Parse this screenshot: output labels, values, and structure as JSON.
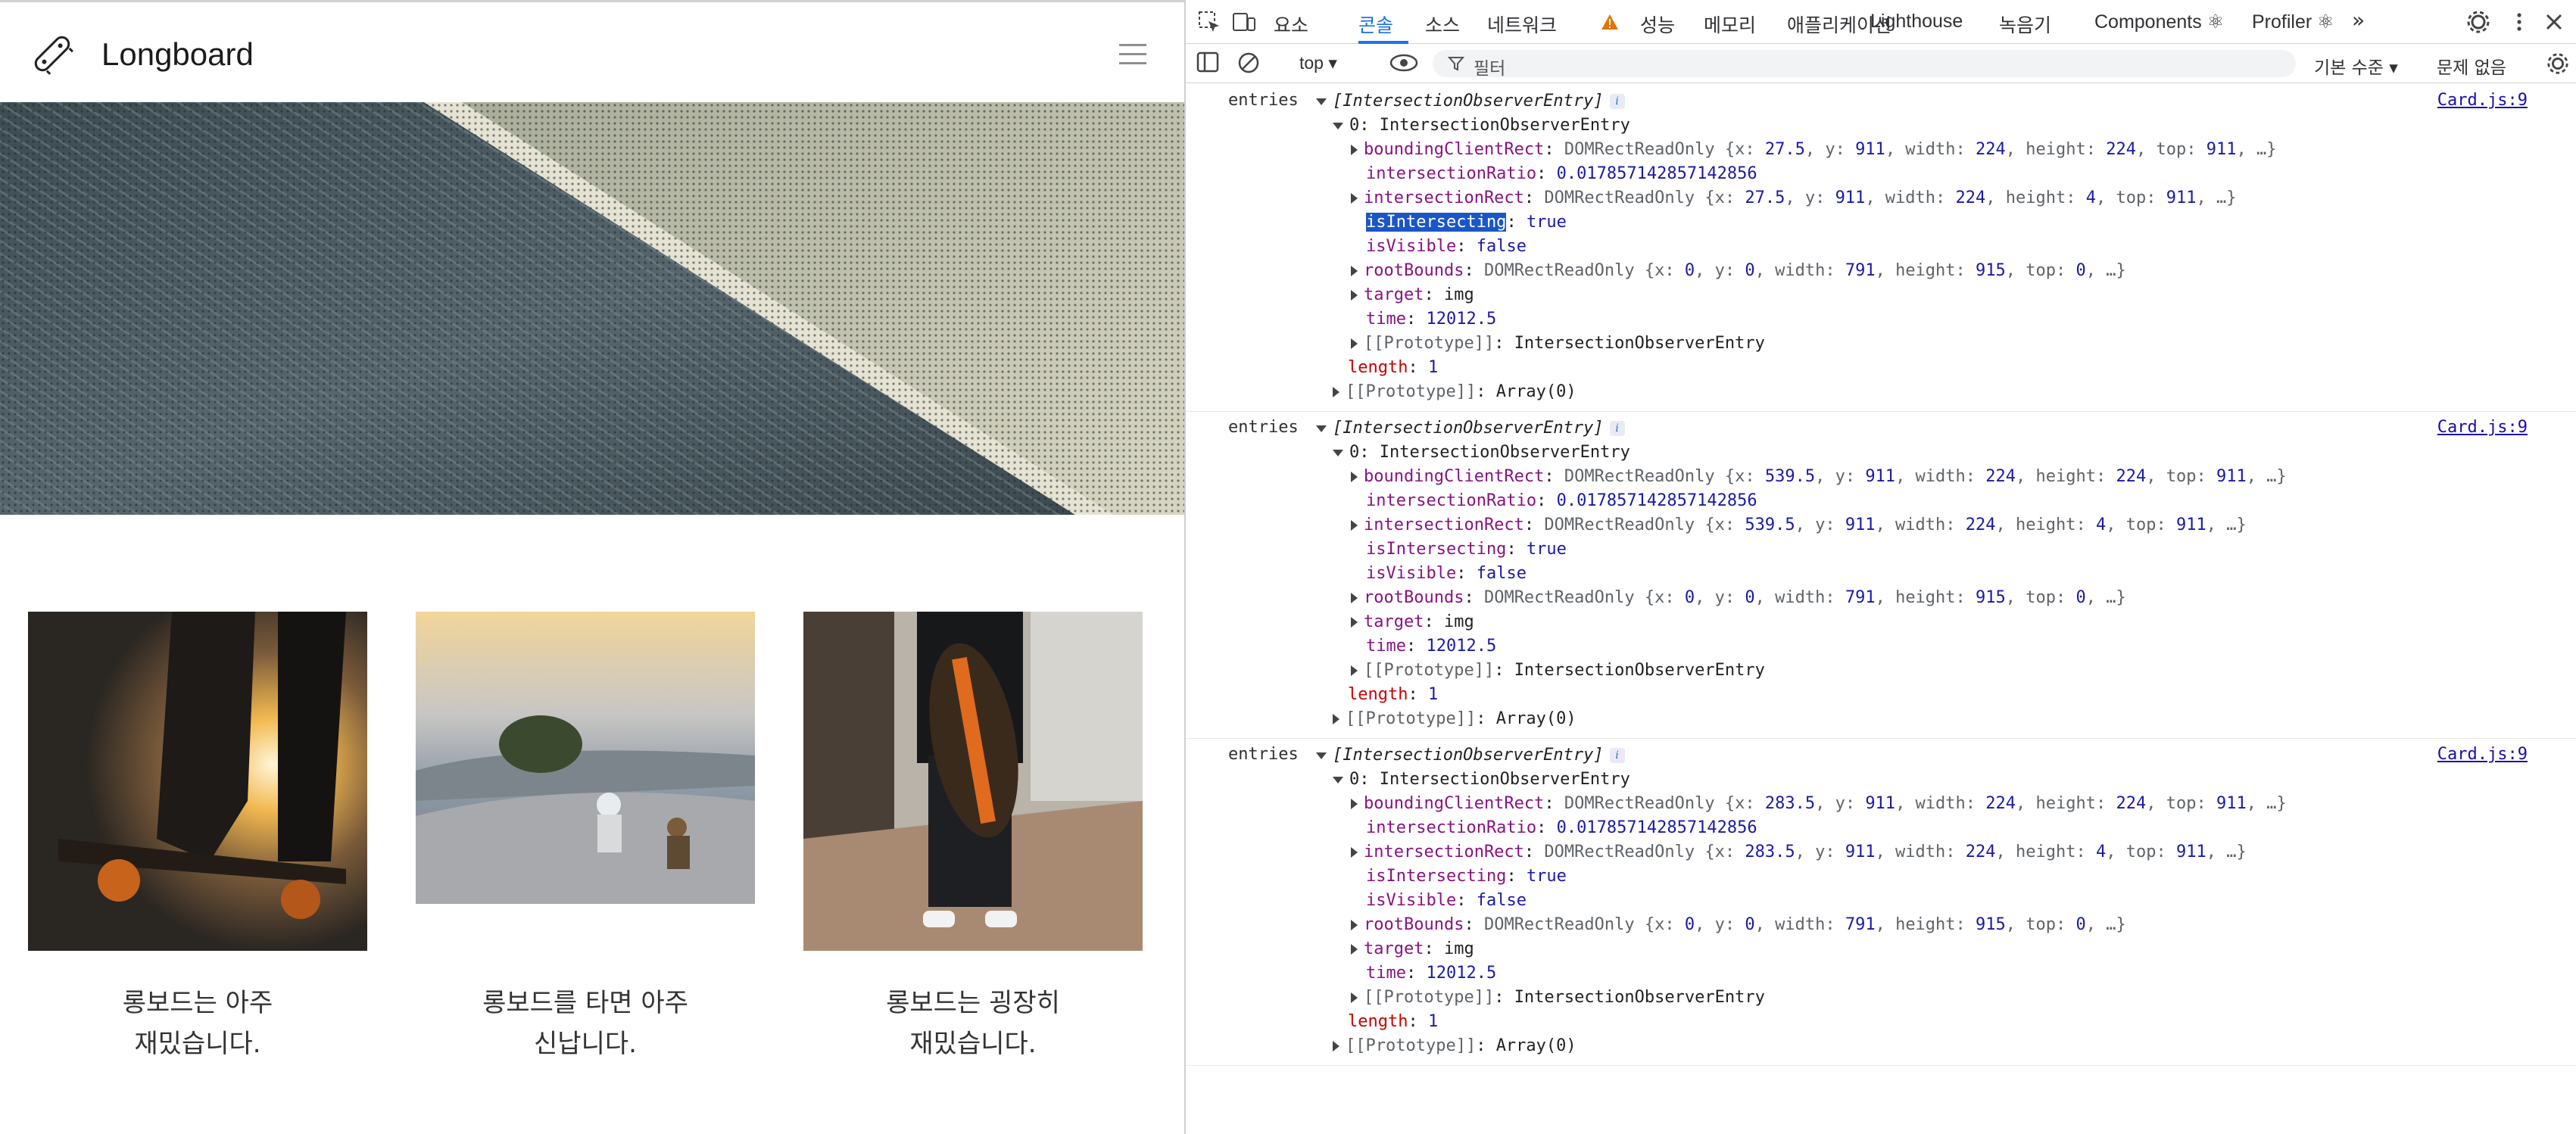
{
  "site": {
    "brand": "Longboard",
    "cards": [
      {
        "title_line1": "롱보드는 아주",
        "title_line2": "재밌습니다."
      },
      {
        "title_line1": "롱보드를 타면 아주",
        "title_line2": "신납니다."
      },
      {
        "title_line1": "롱보드는 굉장히",
        "title_line2": "재밌습니다."
      }
    ]
  },
  "devtools": {
    "tabs": [
      "요소",
      "콘솔",
      "소스",
      "네트워크",
      "성능",
      "메모리",
      "애플리케이션",
      "Lighthouse",
      "녹음기",
      "Components ⚛",
      "Profiler ⚛"
    ],
    "active_tab": "콘솔",
    "toolbar": {
      "context": "top ▾",
      "filter_placeholder": "필터",
      "level": "기본 수준 ▾",
      "issues": "문제 없음"
    },
    "logs": [
      {
        "label": "entries",
        "source": "Card.js:9",
        "x": "27.5",
        "highlight_isIntersecting": true
      },
      {
        "label": "entries",
        "source": "Card.js:9",
        "x": "539.5",
        "highlight_isIntersecting": false
      },
      {
        "label": "entries",
        "source": "Card.js:9",
        "x": "283.5",
        "highlight_isIntersecting": false
      }
    ],
    "common": {
      "array_header": "[IntersectionObserverEntry]",
      "entry_header": "0: IntersectionObserverEntry",
      "y": "911",
      "width": "224",
      "height": "224",
      "top": "911",
      "intersection_height": "4",
      "intersectionRatio": "0.017857142857142856",
      "isIntersecting": "true",
      "isVisible": "false",
      "root_x": "0",
      "root_y": "0",
      "root_width": "791",
      "root_height": "915",
      "root_top": "0",
      "target": "img",
      "time": "12012.5",
      "length": "1",
      "proto_entry": "IntersectionObserverEntry",
      "proto_array": "Array(0)"
    }
  }
}
